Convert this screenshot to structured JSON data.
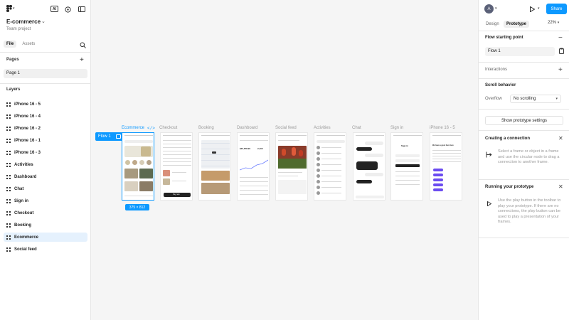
{
  "app": {
    "project_name": "E-commerce",
    "team": "Team project",
    "ai_badge": "AI",
    "colors": {
      "accent": "#0d99ff",
      "selection_bg": "#e5f1fd",
      "canvas": "#f5f5f5"
    }
  },
  "left_panel": {
    "tabs": [
      "File",
      "Assets"
    ],
    "pages_title": "Pages",
    "pages": [
      "Page 1"
    ],
    "layers_title": "Layers",
    "layers": [
      "iPhone 16 - 5",
      "iPhone 16 - 4",
      "iPhone 16 - 2",
      "iPhone 16 - 1",
      "iPhone 16 - 3",
      "Activities",
      "Dashboard",
      "Chat",
      "Sign in",
      "Checkout",
      "Booking",
      "Ecommerce",
      "Social feed"
    ],
    "selected_layer": "Ecommerce"
  },
  "canvas": {
    "flow_badge": "Flow 1",
    "frames": [
      "Ecommerce",
      "Checkout",
      "Booking",
      "Dashboard",
      "Social feed",
      "Activities",
      "Chat",
      "Sign in",
      "iPhone 16 - 5"
    ],
    "selected_frame": "Ecommerce",
    "selection_size": "375 × 812",
    "frame_texts": {
      "checkout_total_button": "Pay now",
      "dashboard_value_1": "$45,678.90",
      "dashboard_value_2": "2,405",
      "signin_title": "Sign in",
      "iphone5_headline": "We have a good hero here"
    }
  },
  "right_panel": {
    "avatar_letter": "A",
    "share_label": "Share",
    "tabs": [
      "Design",
      "Prototype"
    ],
    "active_tab": "Prototype",
    "zoom": "22%",
    "flow_section": "Flow starting point",
    "flow_value": "Flow 1",
    "interactions": "Interactions",
    "scroll_title": "Scroll behavior",
    "overflow_label": "Overflow",
    "overflow_value": "No scrolling",
    "show_settings": "Show prototype settings",
    "creating_title": "Creating a connection",
    "creating_help": "Select a frame or object in a frame and use the circular node to drag a connection to another frame.",
    "running_title": "Running your prototype",
    "running_help": "Use the play button in the toolbar to play your prototype. If there are no connections, the play button can be used to play a presentation of your frames."
  }
}
